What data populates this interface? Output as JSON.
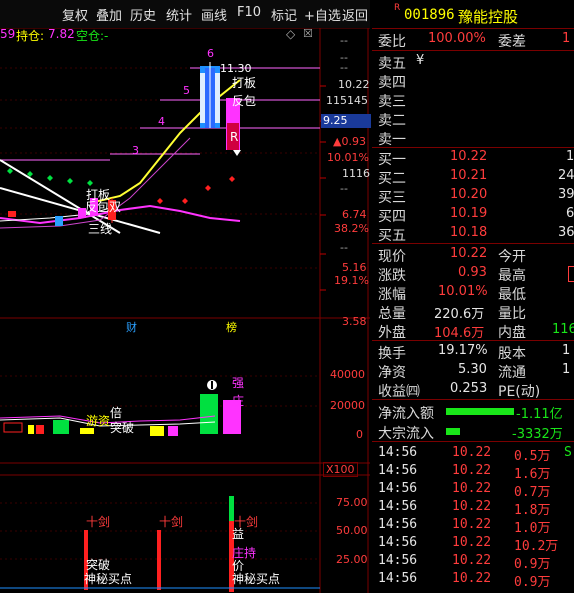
{
  "toolbar": {
    "buttons": [
      "复权",
      "叠加",
      "历史",
      "统计",
      "画线",
      "F10",
      "标记",
      "+自选",
      "返回"
    ]
  },
  "chart": {
    "header": {
      "fragment": "59",
      "hold_label": "持仓:",
      "hold_value": "7.82",
      "empty_label": "空仓:-"
    },
    "price_labels": [
      "10.22",
      "115145",
      "9.25",
      "▲0.93",
      "10.01%",
      "1116",
      "6.74",
      "38.2%",
      "5.16",
      "19.1%",
      "3.58"
    ],
    "price_ticks": [
      "11.30",
      "6",
      "5",
      "4",
      "3"
    ],
    "annotations": [
      "打板",
      "反包",
      "打板",
      "反包双",
      "三线",
      "R",
      "财",
      "榜"
    ],
    "volume_axis": [
      "40000",
      "20000",
      "0"
    ],
    "volume_annotations": [
      "游资",
      "倍",
      "突破",
      "强",
      "庄"
    ],
    "multiplier": "X100",
    "indicator_axis": [
      "75.00",
      "50.00",
      "25.00"
    ],
    "indicator_annotations": [
      "十剑",
      "十剑",
      "十剑",
      "突破",
      "神秘买点",
      "益",
      "庄持",
      "价",
      "神秘买点"
    ]
  },
  "panel": {
    "code": "001896",
    "name": "豫能控股",
    "r_mark": "R",
    "wei_bi_label": "委比",
    "wei_bi_value": "100.00%",
    "wei_cha_label": "委差",
    "wei_cha_value": "1",
    "sell": [
      {
        "label": "卖五",
        "price": "¥",
        "vol": ""
      },
      {
        "label": "卖四",
        "price": "",
        "vol": ""
      },
      {
        "label": "卖三",
        "price": "",
        "vol": ""
      },
      {
        "label": "卖二",
        "price": "",
        "vol": ""
      },
      {
        "label": "卖一",
        "price": "",
        "vol": ""
      }
    ],
    "buy": [
      {
        "label": "买一",
        "price": "10.22",
        "vol": "1"
      },
      {
        "label": "买二",
        "price": "10.21",
        "vol": "24"
      },
      {
        "label": "买三",
        "price": "10.20",
        "vol": "39"
      },
      {
        "label": "买四",
        "price": "10.19",
        "vol": "6"
      },
      {
        "label": "买五",
        "price": "10.18",
        "vol": "36"
      }
    ],
    "stats": [
      {
        "l1": "现价",
        "v1": "10.22",
        "c1": "red",
        "l2": "今开",
        "v2": "",
        "c2": "red"
      },
      {
        "l1": "涨跌",
        "v1": "0.93",
        "c1": "red",
        "l2": "最高",
        "v2": "",
        "c2": "red"
      },
      {
        "l1": "涨幅",
        "v1": "10.01%",
        "c1": "red",
        "l2": "最低",
        "v2": "",
        "c2": "red"
      },
      {
        "l1": "总量",
        "v1": "220.6万",
        "c1": "white",
        "l2": "量比",
        "v2": "",
        "c2": "white"
      },
      {
        "l1": "外盘",
        "v1": "104.6万",
        "c1": "red",
        "l2": "内盘",
        "v2": "116",
        "c2": "green"
      }
    ],
    "stats2": [
      {
        "l1": "换手",
        "v1": "19.17%",
        "l2": "股本",
        "v2": "1"
      },
      {
        "l1": "净资",
        "v1": "5.30",
        "l2": "流通",
        "v2": "1"
      },
      {
        "l1": "收益㈣",
        "v1": "0.253",
        "l2": "PE(动)",
        "v2": ""
      }
    ],
    "flow": [
      {
        "label": "净流入额",
        "value": "-1.11亿",
        "bar": 0.75
      },
      {
        "label": "大宗流入",
        "value": "-3332万",
        "bar": 0.15
      }
    ],
    "trades": [
      {
        "time": "14:56",
        "price": "10.22",
        "vol": "0.5万"
      },
      {
        "time": "14:56",
        "price": "10.22",
        "vol": "1.6万"
      },
      {
        "time": "14:56",
        "price": "10.22",
        "vol": "0.7万"
      },
      {
        "time": "14:56",
        "price": "10.22",
        "vol": "1.8万"
      },
      {
        "time": "14:56",
        "price": "10.22",
        "vol": "1.0万"
      },
      {
        "time": "14:56",
        "price": "10.22",
        "vol": "10.2万"
      },
      {
        "time": "14:56",
        "price": "10.22",
        "vol": "0.9万"
      },
      {
        "time": "14:56",
        "price": "10.22",
        "vol": "0.9万"
      }
    ],
    "trade_flags": [
      "S",
      "",
      "",
      "",
      "",
      "",
      "",
      ""
    ]
  }
}
